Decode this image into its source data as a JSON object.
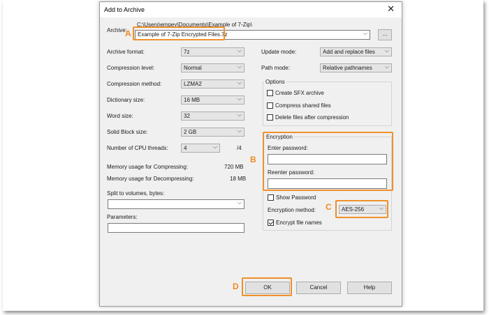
{
  "dialog": {
    "title": "Add to Archive",
    "close_icon": "close-icon"
  },
  "archive": {
    "label": "Archive:",
    "path": "C:\\Users\\empey\\Documents\\Example of 7-Zip\\",
    "value": "Example of 7-Zip Encrypted Files.7z",
    "browse_label": "..."
  },
  "left": {
    "format": {
      "label": "Archive format:",
      "value": "7z"
    },
    "level": {
      "label": "Compression level:",
      "value": "Normal"
    },
    "method": {
      "label": "Compression method:",
      "value": "LZMA2"
    },
    "dict": {
      "label": "Dictionary size:",
      "value": "16 MB"
    },
    "word": {
      "label": "Word size:",
      "value": "32"
    },
    "solid": {
      "label": "Solid Block size:",
      "value": "2 GB"
    },
    "threads": {
      "label": "Number of CPU threads:",
      "value": "4",
      "max": "/4"
    },
    "mem_comp": {
      "label": "Memory usage for Compressing:",
      "value": "720 MB"
    },
    "mem_decomp": {
      "label": "Memory usage for Decompressing:",
      "value": "18 MB"
    },
    "split": {
      "label": "Split to volumes, bytes:",
      "value": ""
    },
    "params": {
      "label": "Parameters:",
      "value": ""
    }
  },
  "right": {
    "update": {
      "label": "Update mode:",
      "value": "Add and replace files"
    },
    "path": {
      "label": "Path mode:",
      "value": "Relative pathnames"
    },
    "options": {
      "title": "Options",
      "sfx": {
        "label": "Create SFX archive",
        "checked": false
      },
      "shared": {
        "label": "Compress shared files",
        "checked": false
      },
      "delete": {
        "label": "Delete files after compression",
        "checked": false
      }
    },
    "encryption": {
      "title": "Encryption",
      "enter_label": "Enter password:",
      "reenter_label": "Reenter password:",
      "show_label": "Show Password",
      "show_checked": false,
      "method_label": "Encryption method:",
      "method_value": "AES-256",
      "names_label": "Encrypt file names",
      "names_checked": true
    }
  },
  "buttons": {
    "ok": "OK",
    "cancel": "Cancel",
    "help": "Help"
  },
  "annotations": {
    "a": "A",
    "b": "B",
    "c": "C",
    "d": "D",
    "color": "#f0902a"
  }
}
